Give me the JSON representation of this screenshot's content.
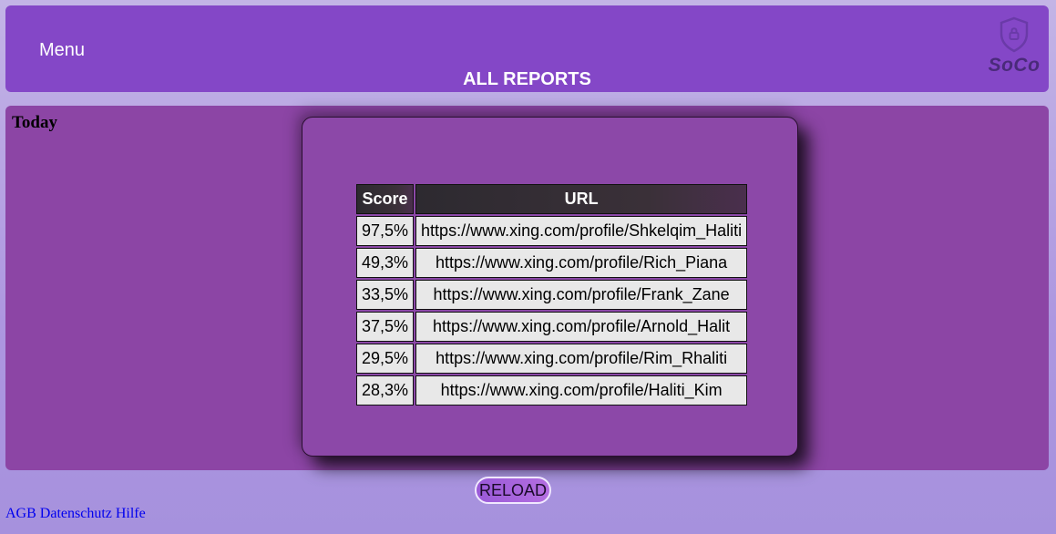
{
  "header": {
    "menu_label": "Menu",
    "title": "ALL REPORTS",
    "logo_text": "SoCo",
    "logo_icon": "shield-lock-icon"
  },
  "main": {
    "section_label": "Today"
  },
  "modal": {
    "columns": {
      "score": "Score",
      "url": "URL"
    },
    "rows": [
      {
        "score": "97,5%",
        "url": "https://www.xing.com/profile/Shkelqim_Haliti"
      },
      {
        "score": "49,3%",
        "url": "https://www.xing.com/profile/Rich_Piana"
      },
      {
        "score": "33,5%",
        "url": "https://www.xing.com/profile/Frank_Zane"
      },
      {
        "score": "37,5%",
        "url": "https://www.xing.com/profile/Arnold_Halit"
      },
      {
        "score": "29,5%",
        "url": "https://www.xing.com/profile/Rim_Rhaliti"
      },
      {
        "score": "28,3%",
        "url": "https://www.xing.com/profile/Haliti_Kim"
      }
    ]
  },
  "reload_label": "RELOAD",
  "footer": {
    "links": [
      "AGB",
      "Datenschutz",
      "Hilfe"
    ]
  },
  "colors": {
    "header_bg": "#8447c7",
    "panel_bg": "#8c45a5",
    "table_header_bg": "#2d2a30",
    "cell_bg": "#e8e8e8",
    "link": "#0000ee"
  }
}
